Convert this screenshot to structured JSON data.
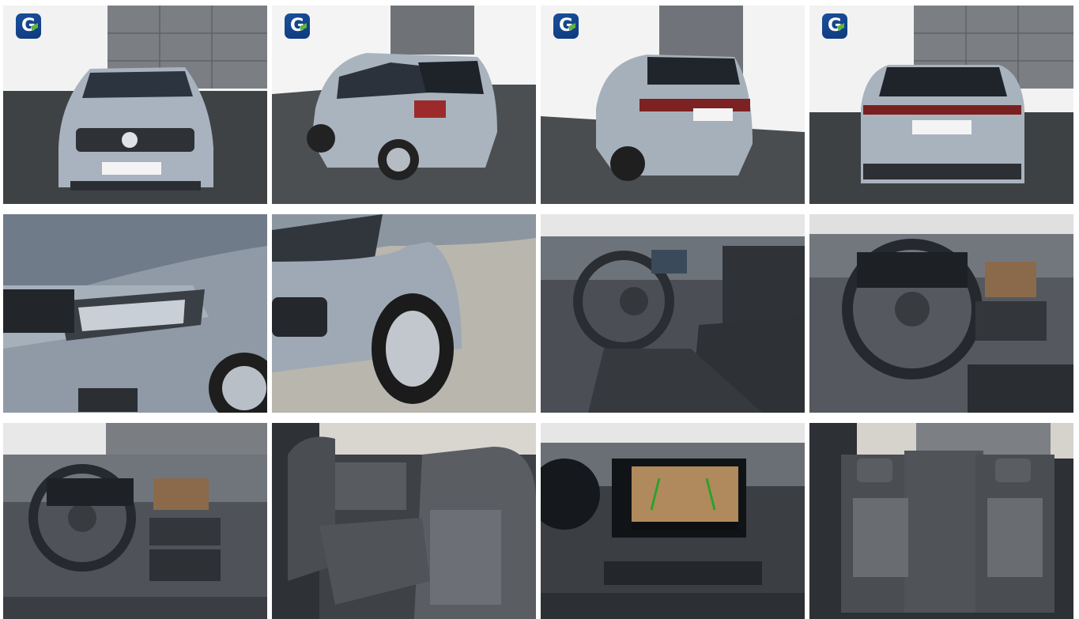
{
  "gallery": {
    "brand_logo": {
      "icon": "dealer-logo-icon",
      "mark": "G"
    },
    "photos": [
      {
        "name": "exterior-front",
        "has_logo": true
      },
      {
        "name": "exterior-rear-left",
        "has_logo": true
      },
      {
        "name": "exterior-rear-three-quarter",
        "has_logo": true
      },
      {
        "name": "exterior-rear",
        "has_logo": true
      },
      {
        "name": "headlight-detail",
        "has_logo": false
      },
      {
        "name": "front-wheel-detail",
        "has_logo": false
      },
      {
        "name": "cockpit-driver-side",
        "has_logo": false
      },
      {
        "name": "steering-wheel-dashboard",
        "has_logo": false
      },
      {
        "name": "dashboard-overview",
        "has_logo": false
      },
      {
        "name": "rear-seats-side",
        "has_logo": false
      },
      {
        "name": "infotainment-rear-camera",
        "has_logo": false
      },
      {
        "name": "rear-seats-front-view",
        "has_logo": false
      }
    ]
  }
}
